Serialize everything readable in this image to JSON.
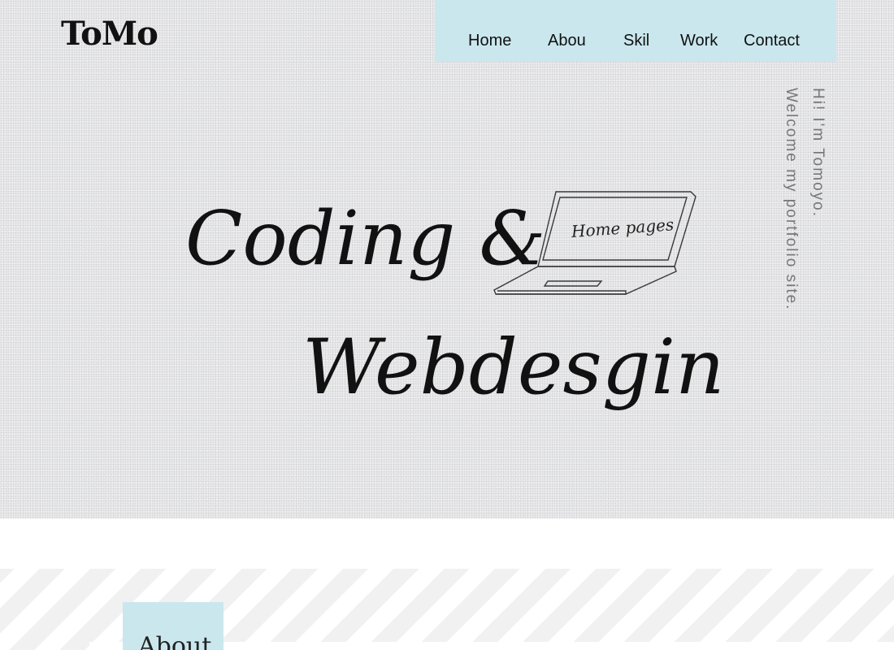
{
  "header": {
    "logo": "ToMo",
    "nav": [
      {
        "label": "Home"
      },
      {
        "label": "Abou"
      },
      {
        "label": "Skil"
      },
      {
        "label": "Work"
      },
      {
        "label": "Contact"
      }
    ]
  },
  "hero": {
    "headline_line1": "Coding &",
    "headline_line2": "Webdesgin",
    "laptop_text": "Home pages",
    "intro_line1": "Hi! I'm Tomoyo.",
    "intro_line2": "Welcome my portfolio site."
  },
  "about": {
    "title": "About"
  },
  "colors": {
    "accent": "#cae7ee",
    "hero_bg": "#e9e9ea",
    "text": "#111111",
    "muted_text": "#777777"
  },
  "icons": [
    "laptop-icon"
  ]
}
